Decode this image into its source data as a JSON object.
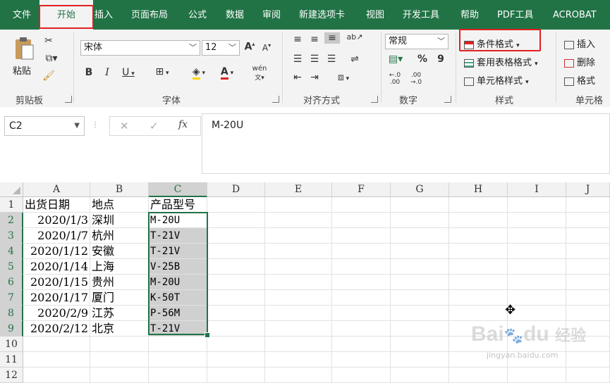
{
  "tabs": [
    "文件",
    "开始",
    "插入",
    "页面布局",
    "公式",
    "数据",
    "审阅",
    "新建选项卡",
    "视图",
    "开发工具",
    "帮助",
    "PDF工具",
    "ACROBAT"
  ],
  "ribbon": {
    "clipboard": {
      "paste": "粘贴",
      "label": "剪贴板"
    },
    "font": {
      "name": "宋体",
      "size": "12",
      "grow": "A",
      "shrink": "A",
      "bold": "B",
      "italic": "I",
      "underline": "U",
      "font_color": "A",
      "phonetic": "wén",
      "label": "字体"
    },
    "alignment": {
      "label": "对齐方式"
    },
    "number": {
      "format": "常规",
      "percent": "%",
      "comma": "9",
      "label": "数字"
    },
    "styles": {
      "conditional_format": "条件格式",
      "table_format": "套用表格格式",
      "cell_styles": "单元格样式",
      "label": "样式"
    },
    "cells": {
      "insert": "插入",
      "delete": "删除",
      "format": "格式",
      "label": "单元格"
    }
  },
  "formula_bar": {
    "name_box": "C2",
    "cancel": "✕",
    "enter": "✓",
    "fx": "fx",
    "content": "M-20U"
  },
  "columns": [
    "A",
    "B",
    "C",
    "D",
    "E",
    "F",
    "G",
    "H",
    "I",
    "J"
  ],
  "rows": [
    "1",
    "2",
    "3",
    "4",
    "5",
    "6",
    "7",
    "8",
    "9",
    "10",
    "11",
    "12"
  ],
  "headers": [
    "出货日期",
    "地点",
    "产品型号"
  ],
  "data": [
    [
      "2020/1/3",
      "深圳",
      "M-20U"
    ],
    [
      "2020/1/7",
      "杭州",
      "T-21V"
    ],
    [
      "2020/1/12",
      "安徽",
      "T-21V"
    ],
    [
      "2020/1/14",
      "上海",
      "V-25B"
    ],
    [
      "2020/1/15",
      "贵州",
      "M-20U"
    ],
    [
      "2020/1/17",
      "厦门",
      "K-50T"
    ],
    [
      "2020/2/9",
      "江苏",
      "P-56M"
    ],
    [
      "2020/2/12",
      "北京",
      "T-21V"
    ]
  ],
  "watermark": {
    "brand": "Bai",
    "brand2": "du",
    "text": "经验",
    "url": "jingyan.baidu.com"
  },
  "colors": {
    "accent": "#217346",
    "highlight": "#e02020",
    "selection": "#d0d0d0"
  }
}
